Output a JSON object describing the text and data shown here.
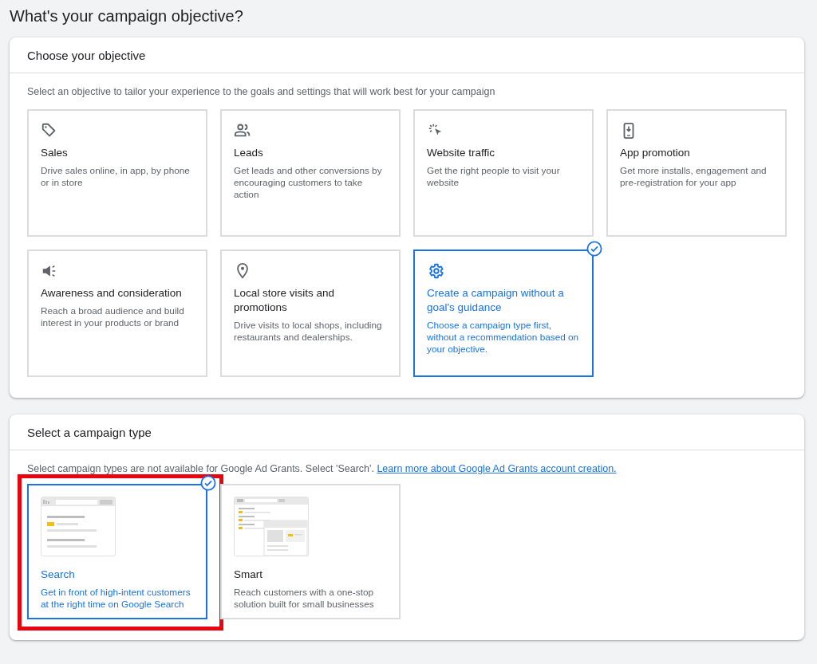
{
  "page_title": "What's your campaign objective?",
  "objective_section": {
    "title": "Choose your objective",
    "intro": "Select an objective to tailor your experience to the goals and settings that will work best for your campaign",
    "options": [
      {
        "kind": "tag",
        "title": "Sales",
        "description": "Drive sales online, in app, by phone or in store",
        "selected": false
      },
      {
        "kind": "people",
        "title": "Leads",
        "description": "Get leads and other conversions by encouraging customers to take action",
        "selected": false
      },
      {
        "kind": "cursor",
        "title": "Website traffic",
        "description": "Get the right people to visit your website",
        "selected": false
      },
      {
        "kind": "phone",
        "title": "App promotion",
        "description": "Get more installs, engagement and pre-registration for your app",
        "selected": false
      },
      {
        "kind": "megaphone",
        "title": "Awareness and consideration",
        "description": "Reach a broad audience and build interest in your products or brand",
        "selected": false
      },
      {
        "kind": "pin",
        "title": "Local store visits and promotions",
        "description": "Drive visits to local shops, including restaurants and dealerships.",
        "selected": false
      },
      {
        "kind": "gear",
        "title": "Create a campaign without a goal's guidance",
        "description": "Choose a campaign type first, without a recommendation based on your objective.",
        "selected": true
      }
    ]
  },
  "campaign_type_section": {
    "title": "Select a campaign type",
    "note": "Select campaign types are not available for Google Ad Grants. Select 'Search'.",
    "link": "Learn more about Google Ad Grants account creation.",
    "types": [
      {
        "kind": "search",
        "title": "Search",
        "description": "Get in front of high-intent customers at the right time on Google Search",
        "selected": true,
        "highlighted": true
      },
      {
        "kind": "smart",
        "title": "Smart",
        "description": "Reach customers with a one-stop solution built for small businesses",
        "selected": false,
        "highlighted": false
      }
    ]
  }
}
